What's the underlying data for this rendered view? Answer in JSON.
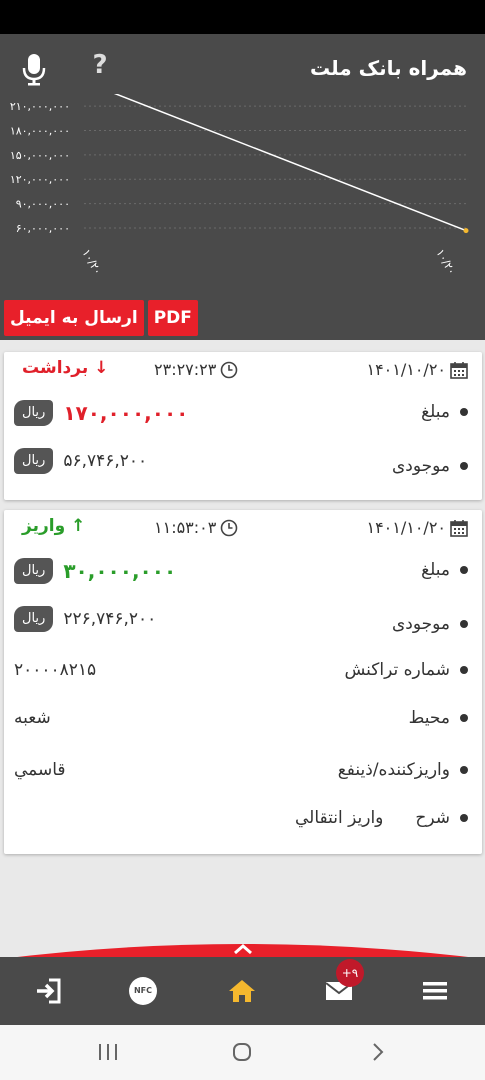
{
  "app": {
    "title": "همراه بانک ملت"
  },
  "header": {
    "help_label": "?"
  },
  "chart_data": {
    "type": "line",
    "title": "",
    "x": [
      "۱۰/۲۰",
      "۱۰/۲۰"
    ],
    "series": [
      {
        "values": [
          226746200,
          56746200
        ]
      }
    ],
    "y_tick_labels": [
      "۲۱۰,۰۰۰,۰۰۰",
      "۱۸۰,۰۰۰,۰۰۰",
      "۱۵۰,۰۰۰,۰۰۰",
      "۱۲۰,۰۰۰,۰۰۰",
      "۹۰,۰۰۰,۰۰۰",
      "۶۰,۰۰۰,۰۰۰"
    ],
    "y_ticks": [
      210000000,
      180000000,
      150000000,
      120000000,
      90000000,
      60000000
    ],
    "x_tick_labels": [
      "۱۰/۲۰",
      "۱۰/۲۰"
    ],
    "ylim": [
      55000000,
      215000000
    ],
    "grid": true,
    "colors": {
      "line": "#ffffff",
      "point": "#f5b82e",
      "grid": "#6a6a6a"
    }
  },
  "actions": {
    "email_label": "ارسال به ایمیل",
    "pdf_label": "PDF"
  },
  "transactions": [
    {
      "date": "۱۴۰۱/۱۰/۲۰",
      "time": "۲۳:۲۷:۲۳",
      "type_label": "برداشت",
      "type_arrow": "↓",
      "amount_label": "مبلغ",
      "amount": "۱۷۰,۰۰۰,۰۰۰",
      "currency": "ریال",
      "balance_label": "موجودی",
      "balance": "۵۶,۷۴۶,۲۰۰",
      "balance_currency": "ریال"
    },
    {
      "date": "۱۴۰۱/۱۰/۲۰",
      "time": "۱۱:۵۳:۰۳",
      "type_label": "واریز",
      "type_arrow": "↑",
      "amount_label": "مبلغ",
      "amount": "۳۰,۰۰۰,۰۰۰",
      "currency": "ریال",
      "balance_label": "موجودی",
      "balance": "۲۲۶,۷۴۶,۲۰۰",
      "balance_currency": "ریال",
      "tracking_label": "شماره تراکنش",
      "tracking": "۲۰۰۰۰۸۲۱۵",
      "channel_label": "محیط",
      "channel": "شعبه",
      "depositor_label": "واریزکننده/ذینفع",
      "depositor": "قاسمي",
      "desc_label": "شرح",
      "desc": "واريز انتقالي"
    }
  ],
  "bottom_nav": {
    "mail_badge": "+۹",
    "nfc_label": "NFC"
  },
  "colors": {
    "accent": "#e8202a",
    "header": "#4a4a4a",
    "home": "#f5b82e",
    "withdraw": "#e0202a",
    "deposit": "#2a9d2a"
  }
}
